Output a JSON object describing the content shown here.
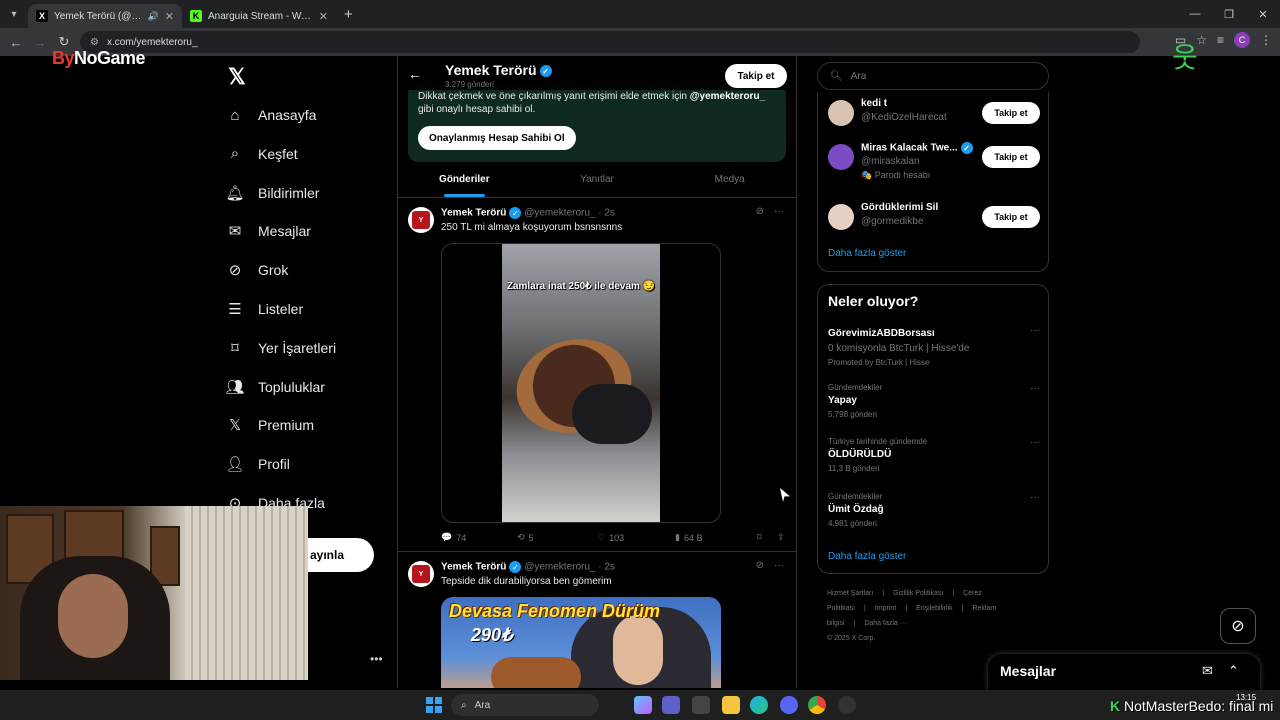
{
  "browser": {
    "tabs": [
      {
        "title": "Yemek Terörü (@yemekteroru_) / X",
        "favicon": "X",
        "active": true
      },
      {
        "title": "Anarguia Stream - Watch Live on Kick",
        "favicon": "K",
        "active": false
      }
    ],
    "new_tab": "+",
    "url": "x.com/yemekteroru_",
    "profile_initial": "C"
  },
  "overlay": {
    "brand_left": "By",
    "brand_right": "NoGame"
  },
  "nav": {
    "items": [
      {
        "label": "Anasayfa",
        "icon": "home-icon"
      },
      {
        "label": "Keşfet",
        "icon": "search-icon"
      },
      {
        "label": "Bildirimler",
        "icon": "bell-icon"
      },
      {
        "label": "Mesajlar",
        "icon": "mail-icon"
      },
      {
        "label": "Grok",
        "icon": "grok-icon"
      },
      {
        "label": "Listeler",
        "icon": "list-icon"
      },
      {
        "label": "Yer İşaretleri",
        "icon": "bookmark-icon"
      },
      {
        "label": "Topluluklar",
        "icon": "communities-icon"
      },
      {
        "label": "Premium",
        "icon": "x-logo-icon"
      },
      {
        "label": "Profil",
        "icon": "person-icon"
      },
      {
        "label": "Daha fazla",
        "icon": "more-circle-icon"
      }
    ],
    "post_button_partial": "ayınla"
  },
  "profile": {
    "name": "Yemek Terörü",
    "post_count": "3.279 gönderi",
    "follow_label": "Takip et",
    "verify_notice_prefix": "Dikkat çekmek ve öne çıkarılmış yanıt erişimi elde etmek için",
    "verify_notice_handle": "@yemekteroru_",
    "verify_notice_suffix": "gibi onaylı hesap sahibi ol.",
    "verify_button": "Onaylanmış Hesap Sahibi Ol",
    "tabs": [
      "Gönderiler",
      "Yanıtlar",
      "Medya"
    ]
  },
  "tweets": [
    {
      "name": "Yemek Terörü",
      "handle": "@yemekteroru_",
      "time": "· 2s",
      "text": "250 TL mi almaya koşuyorum bsnsnsnns",
      "video_caption": "Zamlara inat 250₺ ile devam 😏",
      "replies": "74",
      "retweets": "5",
      "likes": "103",
      "views": "64 B"
    },
    {
      "name": "Yemek Terörü",
      "handle": "@yemekteroru_",
      "time": "· 2s",
      "text": "Tepside dik durabiliyorsa ben gömerim",
      "image_title": "Devasa Fenomen Dürüm",
      "image_price": "290₺"
    }
  ],
  "search": {
    "placeholder": "Ara"
  },
  "who_to_follow": [
    {
      "name": "kedi t",
      "handle": "@KediOzelHarecat",
      "sub": "",
      "verified": false,
      "button": "Takip et",
      "color": "#d9c3b0"
    },
    {
      "name": "Miras Kalacak Twe...",
      "handle": "@miraskalan",
      "sub": "🎭 Parodi hesabı",
      "verified": true,
      "button": "Takip et",
      "color": "#7a4bc2"
    },
    {
      "name": "Gördüklerimi Sil",
      "handle": "@gormedikbe",
      "sub": "",
      "verified": false,
      "button": "Takip et",
      "color": "#e8cfc4"
    }
  ],
  "who_more": "Daha fazla göster",
  "trends": {
    "title": "Neler oluyor?",
    "items": [
      {
        "category": "",
        "name": "GörevimizABDBorsası",
        "count": "0 komisyonla BtcTurk | Hisse'de",
        "promo": "Promoted by BtcTurk | Hisse"
      },
      {
        "category": "Gündemdekiler",
        "name": "Yapay",
        "count": "5.798 gönderi",
        "promo": ""
      },
      {
        "category": "Türkiye tarihinde gündemde",
        "name": "ÖLDÜRÜLDÜ",
        "count": "11,3 B gönderi",
        "promo": ""
      },
      {
        "category": "Gündemdekiler",
        "name": "Ümit Özdağ",
        "count": "4.981 gönderi",
        "promo": ""
      }
    ],
    "more": "Daha fazla göster"
  },
  "footer": {
    "links": [
      "Hizmet Şartları",
      "|",
      "Gizlilik Politikası",
      "|",
      "Çerez Politikası",
      "|",
      "Imprint",
      "|",
      "Erişilebilirlik",
      "|",
      "Reklam bilgisi",
      "|",
      "Daha fazla ···"
    ],
    "copyright": "© 2025 X Corp."
  },
  "messages_drawer": {
    "title": "Mesajlar"
  },
  "taskbar": {
    "search_placeholder": "Ara",
    "time": "13:15",
    "ticker_text": "NotMasterBedo: final mi"
  }
}
